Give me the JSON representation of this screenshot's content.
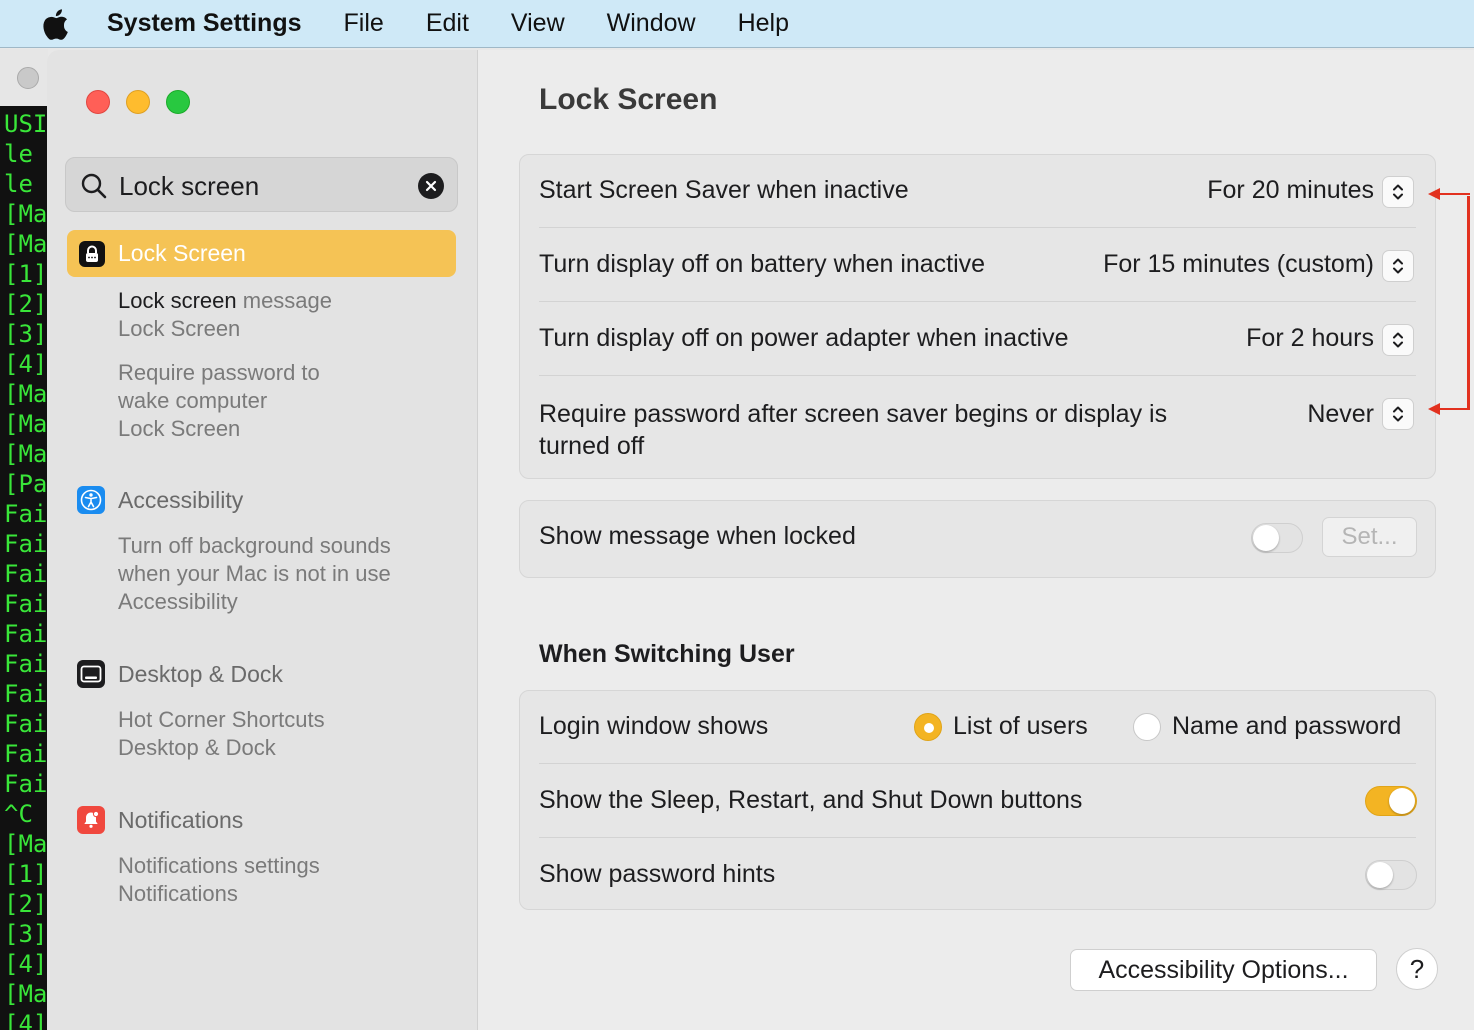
{
  "menubar": {
    "app_name": "System Settings",
    "items": [
      "File",
      "Edit",
      "View",
      "Window",
      "Help"
    ]
  },
  "terminal": {
    "lines": [
      "USI",
      "le",
      "le",
      "[Mac",
      "[Mac",
      "[1]",
      "[2]",
      "[3]",
      "[4]",
      "[Mac",
      "[Mac",
      "[Mac",
      "[Pas",
      "Fai",
      "Fai",
      "Fai",
      "Fai",
      "Fai",
      "Fai",
      "Fai",
      "Fai",
      "Fai",
      "Fai",
      "^C",
      "[Mac",
      "[1]",
      "[2]",
      "[3]",
      "[4]",
      "[Mac",
      "[4]"
    ]
  },
  "sidebar": {
    "search_value": "Lock screen",
    "selected": "Lock Screen",
    "lock_results": [
      {
        "title_match": "Lock screen",
        "title_rest": " message",
        "sub": "Lock Screen"
      },
      {
        "title": "Require password to wake computer",
        "line1": "Require password to",
        "line2": "wake computer",
        "sub": "Lock Screen"
      }
    ],
    "groups": [
      {
        "name": "Accessibility",
        "icon": "accessibility-icon",
        "results": [
          {
            "line1": "Turn off background sounds",
            "line2": "when your Mac is not in use",
            "sub": "Accessibility"
          }
        ]
      },
      {
        "name": "Desktop & Dock",
        "icon": "desktop-dock-icon",
        "results": [
          {
            "line1": "Hot Corner Shortcuts",
            "sub": "Desktop & Dock"
          }
        ]
      },
      {
        "name": "Notifications",
        "icon": "notifications-icon",
        "results": [
          {
            "line1": "Notifications settings",
            "sub": "Notifications"
          }
        ]
      }
    ]
  },
  "main": {
    "title": "Lock Screen",
    "rows": [
      {
        "label": "Start Screen Saver when inactive",
        "value": "For 20 minutes"
      },
      {
        "label": "Turn display off on battery when inactive",
        "value": "For 15 minutes (custom)"
      },
      {
        "label": "Turn display off on power adapter when inactive",
        "value": "For 2 hours"
      },
      {
        "label_line1": "Require password after screen saver begins or display is",
        "label_line2": "turned off",
        "value": "Never"
      }
    ],
    "message": {
      "label": "Show message when locked",
      "toggle_on": false,
      "set_label": "Set..."
    },
    "switching_title": "When Switching User",
    "login": {
      "label": "Login window shows",
      "option1": "List of users",
      "option2": "Name and password",
      "selected": "List of users"
    },
    "sleep_buttons": {
      "label": "Show the Sleep, Restart, and Shut Down buttons",
      "toggle_on": true
    },
    "hints": {
      "label": "Show password hints",
      "toggle_on": false
    },
    "accessibility_button": "Accessibility Options...",
    "help_button": "?"
  },
  "colors": {
    "accent": "#f3b423",
    "selection": "#f5c355",
    "annotation": "#e2311f"
  }
}
